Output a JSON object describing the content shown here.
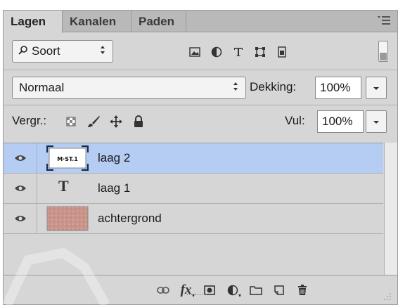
{
  "tabs": [
    {
      "label": "Lagen",
      "active": true
    },
    {
      "label": "Kanalen",
      "active": false
    },
    {
      "label": "Paden",
      "active": false
    }
  ],
  "filter": {
    "label": "Soort",
    "icons": [
      "image-filter-icon",
      "adjustment-filter-icon",
      "type-filter-icon",
      "shape-filter-icon",
      "smart-object-filter-icon"
    ]
  },
  "blend": {
    "mode": "Normaal",
    "opacity_label": "Dekking:",
    "opacity_value": "100%"
  },
  "lock": {
    "label": "Vergr.:",
    "icons": [
      "lock-transparent-icon",
      "lock-paint-icon",
      "lock-position-icon",
      "lock-all-icon"
    ]
  },
  "fill": {
    "label": "Vul:",
    "value": "100%"
  },
  "layers": [
    {
      "name": "laag 2",
      "selected": true,
      "thumb": "smart-object-thumbnail"
    },
    {
      "name": "laag 1",
      "selected": false,
      "thumb": "type-layer-glyph"
    },
    {
      "name": "achtergrond",
      "selected": false,
      "thumb": "texture-thumbnail"
    }
  ],
  "thumbnail_text": "M·ST.1",
  "type_glyph": "T",
  "colors": {
    "panel": "#d6d6d6",
    "selected_row": "#b5ccf3",
    "tab_bar": "#b9b9b9"
  },
  "footer_icons": [
    "link-icon",
    "fx-icon",
    "mask-icon",
    "adjustment-icon",
    "folder-icon",
    "new-layer-icon",
    "trash-icon"
  ],
  "footer_fx_label": "fx"
}
